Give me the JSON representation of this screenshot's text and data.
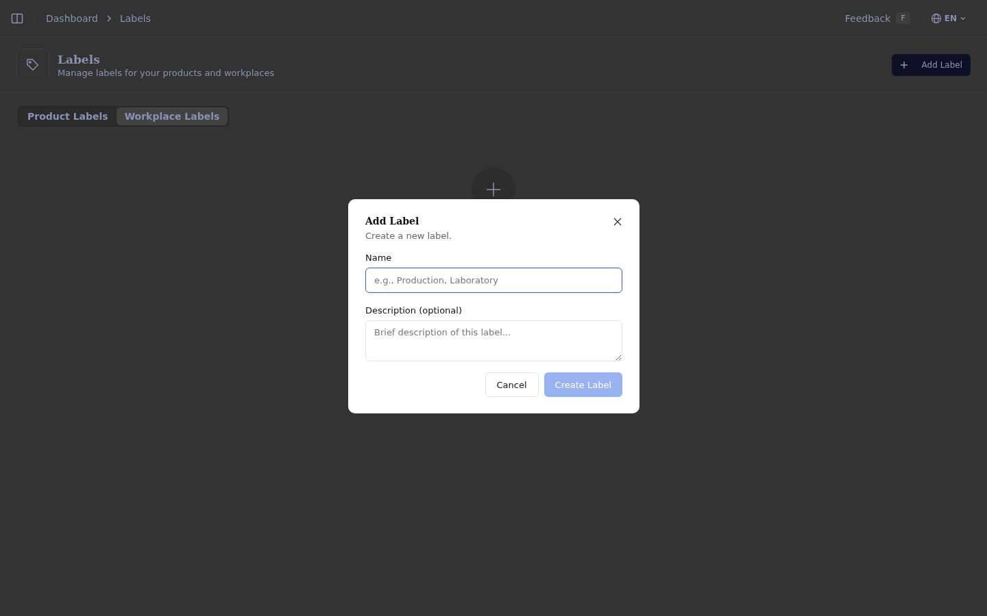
{
  "breadcrumbs": [
    {
      "label": "Dashboard"
    },
    {
      "label": "Labels"
    }
  ],
  "header_actions": {
    "feedback": "Feedback",
    "feedback_key": "F",
    "language": "EN"
  },
  "page": {
    "title": "Labels",
    "subtitle": "Manage labels for your products and workplaces",
    "add_button": "Add Label"
  },
  "tabs": [
    {
      "label": "Product Labels",
      "selected": false
    },
    {
      "label": "Workplace Labels",
      "selected": true
    }
  ],
  "dialog": {
    "title": "Add Label",
    "description": "Create a new label.",
    "fields": [
      {
        "kind": "input",
        "label": "Name",
        "placeholder": "e.g., Production, Laboratory",
        "focused": true
      },
      {
        "kind": "textarea",
        "label": "Description (optional)",
        "placeholder": "Brief description of this label...",
        "focused": false
      }
    ],
    "buttons": [
      {
        "label": "Cancel",
        "kind": "secondary",
        "disabled": false
      },
      {
        "label": "Create Label",
        "kind": "primary",
        "disabled": true
      }
    ]
  }
}
